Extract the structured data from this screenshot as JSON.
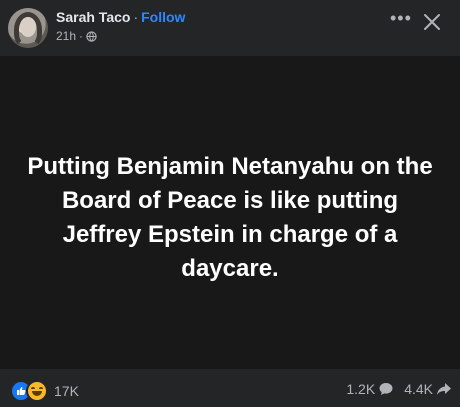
{
  "header": {
    "author_name": "Sarah Taco",
    "separator": "·",
    "follow_label": "Follow",
    "timestamp": "21h",
    "dot": "·",
    "more_icon": "more-horizontal-icon",
    "close_icon": "close-icon",
    "audience_icon": "globe-icon"
  },
  "post": {
    "text": "Putting Benjamin Netanyahu on the Board of Peace is like putting Jeffrey Epstein in charge of a daycare.",
    "background_color": "#181818"
  },
  "footer": {
    "reaction_icons": [
      "like-icon",
      "haha-icon"
    ],
    "reaction_count": "17K",
    "comment_count": "1.2K",
    "share_count": "4.4K"
  },
  "colors": {
    "accent": "#2d88ff",
    "surface": "#242526",
    "muted_text": "#b0b3b8"
  }
}
